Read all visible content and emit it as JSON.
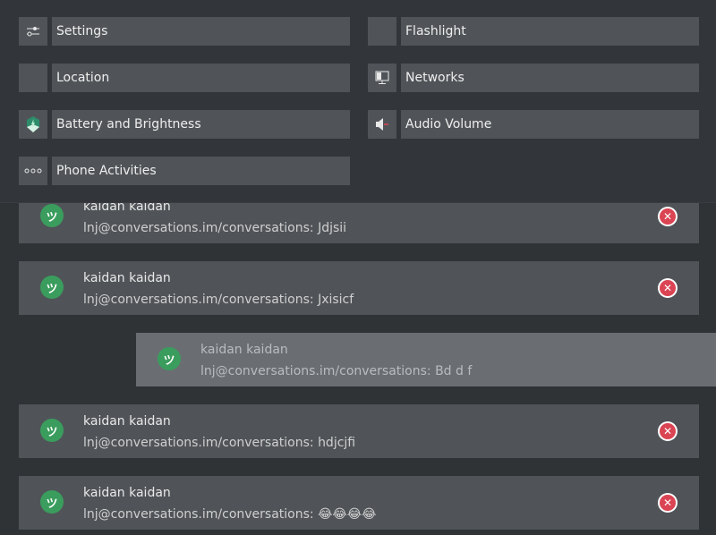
{
  "quick_settings": {
    "settings": "Settings",
    "flashlight": "Flashlight",
    "location": "Location",
    "networks": "Networks",
    "battery": "Battery and Brightness",
    "audio": "Audio Volume",
    "activities": "Phone Activities"
  },
  "notifications": [
    {
      "title": "kaidan kaidan",
      "body": "lnj@conversations.im/conversations: Jdjsii"
    },
    {
      "title": "kaidan kaidan",
      "body": "lnj@conversations.im/conversations: Jxisicf"
    },
    {
      "title": "kaidan kaidan",
      "body": "lnj@conversations.im/conversations: Bd d f"
    },
    {
      "title": "kaidan kaidan",
      "body": "lnj@conversations.im/conversations: hdjcjfi"
    },
    {
      "title": "kaidan kaidan",
      "body": "lnj@conversations.im/conversations: 😂😂😂😂"
    }
  ],
  "icons": {
    "app": "kaidan-app-icon",
    "close": "close-icon"
  },
  "colors": {
    "background": "#2f3336",
    "tile": "#505458",
    "app_accent": "#3a9d5d",
    "close_red": "#da4453",
    "dragging_card": "#6a6e72"
  }
}
